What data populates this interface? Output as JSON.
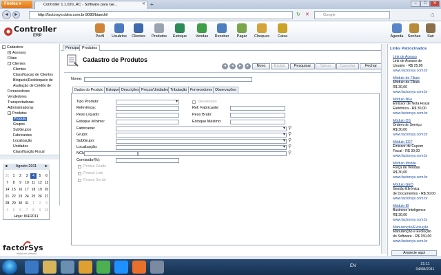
{
  "browser": {
    "menu_label": "Firefox",
    "tab_title": "Controller 1.1.020_RC - Software para Ge...",
    "url": "http://factorsys.ddns.com.br:8080/bianchi/",
    "search_placeholder": "Google"
  },
  "app": {
    "logo_text": "Controller",
    "logo_sub": "ERP",
    "toolbar": [
      "Perfil",
      "Usuários",
      "Clientes",
      "Produtos",
      "Estoque",
      "Vendas",
      "Receber",
      "Pagar",
      "Cheques",
      "Caixa"
    ],
    "right_toolbar": [
      "Agenda",
      "Senhas",
      "Sair"
    ]
  },
  "colors": {
    "accent": "#2f5fb0",
    "header_bg": "#e9eef5",
    "taskbar": "#1d3a5e"
  },
  "tree": {
    "items": [
      {
        "label": "Cadastros",
        "level": 0,
        "toggle": "-"
      },
      {
        "label": "Acessos",
        "level": 1,
        "toggle": "+"
      },
      {
        "label": "Filiais",
        "level": 1,
        "toggle": ""
      },
      {
        "label": "Clientes",
        "level": 1,
        "toggle": "-"
      },
      {
        "label": "Clientes",
        "level": 2,
        "toggle": ""
      },
      {
        "label": "Classificacao de Clientes",
        "level": 2,
        "toggle": ""
      },
      {
        "label": "Bloqueio/Desbloqueio de",
        "level": 2,
        "toggle": ""
      },
      {
        "label": "Avaliação de Crédito de",
        "level": 2,
        "toggle": ""
      },
      {
        "label": "Fornecedores",
        "level": 1,
        "toggle": ""
      },
      {
        "label": "Vendedores",
        "level": 1,
        "toggle": ""
      },
      {
        "label": "Transportadoras",
        "level": 1,
        "toggle": ""
      },
      {
        "label": "Administradoras",
        "level": 1,
        "toggle": ""
      },
      {
        "label": "Produtos",
        "level": 1,
        "toggle": "-"
      },
      {
        "label": "Produto",
        "level": 2,
        "toggle": "",
        "selected": true
      },
      {
        "label": "Grupos",
        "level": 2,
        "toggle": ""
      },
      {
        "label": "SubGrupos",
        "level": 2,
        "toggle": ""
      },
      {
        "label": "Fabricantes",
        "level": 2,
        "toggle": ""
      },
      {
        "label": "Localização",
        "level": 2,
        "toggle": ""
      },
      {
        "label": "Unidades",
        "level": 2,
        "toggle": ""
      },
      {
        "label": "Classificação Fiscal",
        "level": 2,
        "toggle": ""
      }
    ]
  },
  "calendar": {
    "month": "Agosto 2011",
    "prev": "◄",
    "next": "►",
    "weeks": [
      [
        "31",
        "1",
        "2",
        "3",
        "4",
        "5",
        "6"
      ],
      [
        "7",
        "8",
        "9",
        "10",
        "11",
        "12",
        "13"
      ],
      [
        "14",
        "15",
        "16",
        "17",
        "18",
        "19",
        "20"
      ],
      [
        "21",
        "22",
        "23",
        "24",
        "25",
        "26",
        "27"
      ],
      [
        "28",
        "29",
        "30",
        "31",
        "1",
        "2",
        "3"
      ],
      [
        "4",
        "5",
        "6",
        "7",
        "8",
        "9",
        "10"
      ]
    ],
    "today_label": "Hoje: 8/4/2011"
  },
  "brand": {
    "name": "factorSys",
    "tagline": "ideias em software"
  },
  "main": {
    "tabs": [
      "Principal",
      "Produtos"
    ],
    "title": "Cadastro de Produtos",
    "buttons": {
      "novo": "Novo",
      "excluir": "Excluir",
      "pesquisar": "Pesquisar",
      "salvar": "Salvar",
      "cancelar": "Cancelar",
      "fechar": "Fechar"
    },
    "name_label": "Nome:",
    "form_tabs": [
      "Dados do Produto",
      "Estoque",
      "Descrições",
      "Preços/Unidades",
      "Tributação",
      "Fornecedores",
      "Observações"
    ],
    "fields": {
      "tipo_produto": "Tipo Produto:",
      "desativado": "Desativado",
      "referencia": "Referência:",
      "ref_fabricante": "Ref. Fabricante:",
      "peso_liquido": "Peso Líquido:",
      "peso_bruto": "Peso Bruto:",
      "estoque_minimo": "Estoque Mínimo:",
      "estoque_maximo": "Estoque Máximo:",
      "fabricante": "Fabricante:",
      "grupo": "Grupo:",
      "subgrupo": "SubGrupo:",
      "localizacao": "Localização:",
      "ncm": "NCM:",
      "comissao": "Comissão(%):",
      "possui_grade": "Possui Grade",
      "possui_lote": "Possui Lote",
      "possui_serial": "Possui Serial"
    }
  },
  "ads": {
    "header": "Links Patrocinados",
    "items": [
      {
        "title": "Link de Acesso",
        "lines": [
          "Link de Acesso de",
          "Usuário - R$ 25,00"
        ],
        "url": "www.factorsys.com.br"
      },
      {
        "title": "Módulo de Filiais",
        "lines": [
          "Módulo de Filiais",
          "R$ 30,00"
        ],
        "url": "www.factorsys.com.br"
      },
      {
        "title": "Módulo NFe",
        "lines": [
          "Emissor de Nota Fiscal",
          "Eletrônica - R$ 30,00"
        ],
        "url": "www.factorsys.com.br"
      },
      {
        "title": "Módulo OS",
        "lines": [
          "Ordem de Serviço",
          "R$ 30,00"
        ],
        "url": "www.factorsys.com.br"
      },
      {
        "title": "Módulo ECF",
        "lines": [
          "Emissor de Cupom",
          "Fiscal - R$ 30,00"
        ],
        "url": "www.factorsys.com.br"
      },
      {
        "title": "Módulo Mobile",
        "lines": [
          "Força de Vendas",
          "R$ 30,00"
        ],
        "url": "www.factorsys.com.br"
      },
      {
        "title": "Módulo GED",
        "lines": [
          "Gestão Eltrônica",
          "de Documentos - R$ 30,00"
        ],
        "url": "www.factorsys.com.br"
      },
      {
        "title": "Módulo BI",
        "lines": [
          "Business Inteligence",
          "R$ 30,00"
        ],
        "url": "www.factorsys.com.br"
      },
      {
        "title": "Manutenção/Evolução",
        "lines": [
          "Manutenção e Evolução",
          "do Software - R$ 150,00"
        ],
        "url": "www.factorsys.com.br"
      }
    ],
    "footer": "Anuncie aqui"
  },
  "taskbar": {
    "lang": "EN",
    "time": "21:11",
    "date": "04/08/2011"
  }
}
